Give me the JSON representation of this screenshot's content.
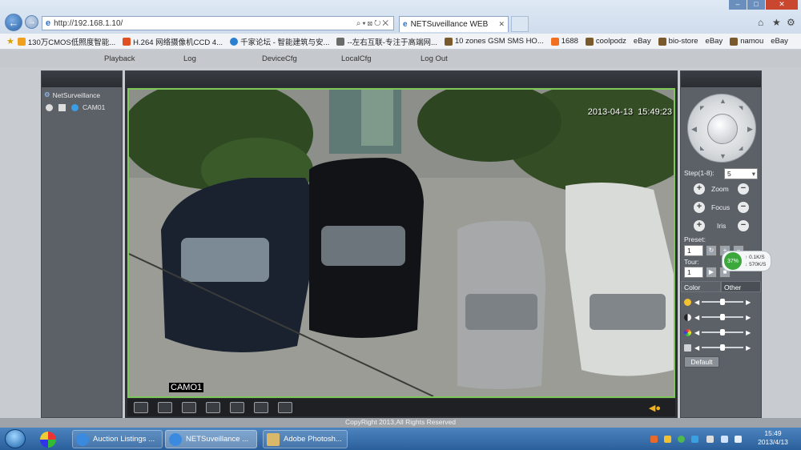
{
  "browser": {
    "address_url": "http://192.168.1.10/",
    "tab_title": "NETSuveillance WEB",
    "favorites": [
      {
        "label": "130万CMOS低照度智能...",
        "color": "#f0a020"
      },
      {
        "label": "H.264 网络摄像机CCD 4...",
        "color": "#e05020"
      },
      {
        "label": "千家论坛 - 智能建筑与安...",
        "color": "#2a7fd0"
      },
      {
        "label": "--左右互联-专注于高端网...",
        "color": "#6a6a6a"
      },
      {
        "label": "10 zones GSM SMS HO...",
        "color": "#7a5a2a"
      },
      {
        "label": "1688",
        "color": "#f07020"
      },
      {
        "label": "coolpodz",
        "color": "#7a5a2a"
      },
      {
        "label": "eBay",
        "color": "#ffffff"
      },
      {
        "label": "bio-store",
        "color": "#7a5a2a"
      },
      {
        "label": "eBay",
        "color": "#ffffff"
      },
      {
        "label": "namou",
        "color": "#7a5a2a"
      },
      {
        "label": "eBay",
        "color": "#ffffff"
      }
    ]
  },
  "app_menu": {
    "items": [
      "Playback",
      "Log",
      "DeviceCfg",
      "LocalCfg",
      "Log Out"
    ]
  },
  "device_tree": {
    "root": "NetSurveillance",
    "camera": "CAM01"
  },
  "video": {
    "timestamp": "2013-04-13  15:49:23",
    "channel_label": "CAMO1"
  },
  "ptz": {
    "step_label": "Step(1-8):",
    "step_value": "5",
    "zoom_label": "Zoom",
    "focus_label": "Focus",
    "iris_label": "Iris",
    "preset_label": "Preset:",
    "preset_value": "1",
    "tour_label": "Tour:",
    "tour_value": "1"
  },
  "color_tabs": [
    "Color",
    "Other"
  ],
  "color_default_button": "Default",
  "net_monitor": {
    "percent": "37%",
    "upload": "0.1K/S",
    "download": "570K/S"
  },
  "copyright": "CopyRight 2013,All Rights Reserved",
  "taskbar": {
    "items": [
      "Auction Listings ...",
      "NETSuveillance ...",
      "Adobe Photosh..."
    ],
    "time": "15:49",
    "date": "2013/4/13"
  }
}
